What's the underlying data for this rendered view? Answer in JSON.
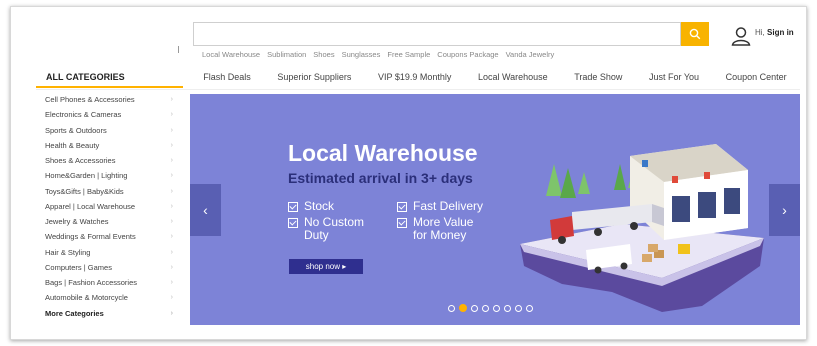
{
  "header": {
    "search": {
      "placeholder": "",
      "value": ""
    },
    "search_icon": "search-icon",
    "hot_words": [
      "Local Warehouse",
      "Sublimation",
      "Shoes",
      "Sunglasses",
      "Free Sample",
      "Coupons Package",
      "Vanda Jewelry"
    ],
    "user": {
      "greeting": "Hi,",
      "sign_in": "Sign in",
      "icon": "user-icon"
    }
  },
  "categories": {
    "header": "ALL CATEGORIES",
    "items": [
      "Cell Phones & Accessories",
      "Electronics & Cameras",
      "Sports & Outdoors",
      "Health & Beauty",
      "Shoes & Accessories",
      "Home&Garden  |  Lighting",
      "Toys&Gifts  |  Baby&Kids",
      "Apparel  |  Local Warehouse",
      "Jewelry & Watches",
      "Weddings & Formal Events",
      "Hair & Styling",
      "Computers  |  Games",
      "Bags  |  Fashion Accessories",
      "Automobile & Motorcycle"
    ],
    "more": "More Categories"
  },
  "nav": [
    "Flash Deals",
    "Superior Suppliers",
    "VIP $19.9 Monthly",
    "Local Warehouse",
    "Trade Show",
    "Just For You",
    "Coupon Center"
  ],
  "banner": {
    "title": "Local Warehouse",
    "subtitle": "Estimated arrival in 3+ days",
    "features": [
      {
        "line1": "Stock",
        "line2": ""
      },
      {
        "line1": "No Custom",
        "line2": "Duty"
      },
      {
        "line1": "Fast Delivery",
        "line2": ""
      },
      {
        "line1": "More Value",
        "line2": "for Money"
      }
    ],
    "button": "shop now ▸",
    "left_arrow": "‹",
    "right_arrow": "›",
    "slide_count": 8,
    "active_slide": 2,
    "colors": {
      "background": "#7d83d7",
      "subtitle": "#2b2f7a",
      "button": "#2f2f8f",
      "accent": "#ffb200"
    }
  }
}
